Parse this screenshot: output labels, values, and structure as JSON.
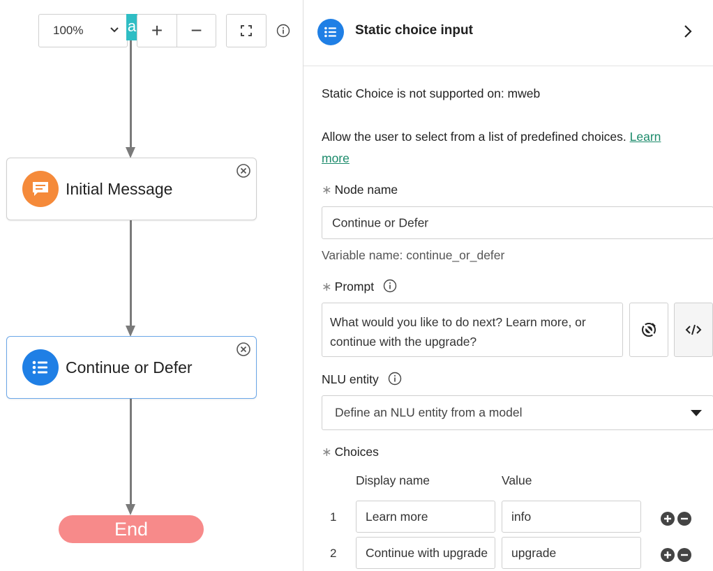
{
  "toolbar": {
    "zoom_value": "100%",
    "teal_tab_letter": "a",
    "zoom_in_label": "+",
    "zoom_out_label": "−"
  },
  "canvas": {
    "nodes": [
      {
        "label": "Initial Message",
        "icon": "message-icon",
        "icon_color": "#f58a3a"
      },
      {
        "label": "Continue or Defer",
        "icon": "list-icon",
        "icon_color": "#1f7fe5"
      }
    ],
    "end_label": "End",
    "end_color": "#f78a8a"
  },
  "panel": {
    "title": "Static choice input",
    "not_supported": "Static Choice is not supported on: mweb",
    "description": "Allow the user to select from a list of predefined choices.",
    "learn_more_part1": "Learn",
    "learn_more_part2": "more",
    "node_name_label": "Node name",
    "node_name_value": "Continue or Defer",
    "variable_name": "Variable name: continue_or_defer",
    "prompt_label": "Prompt",
    "prompt_line1": "What would you like to do next? Learn more, or",
    "prompt_line2": "continue with the upgrade?",
    "nlu_label": "NLU entity",
    "nlu_placeholder": "Define an NLU entity from a model",
    "choices_label": "Choices",
    "col_display": "Display name",
    "col_value": "Value",
    "choices": [
      {
        "num": "1",
        "display": "Learn more",
        "value": "info"
      },
      {
        "num": "2",
        "display": "Continue with upgrade",
        "value": "upgrade"
      }
    ],
    "accent_color": "#1f7fe5",
    "link_color": "#1a8a6a"
  }
}
